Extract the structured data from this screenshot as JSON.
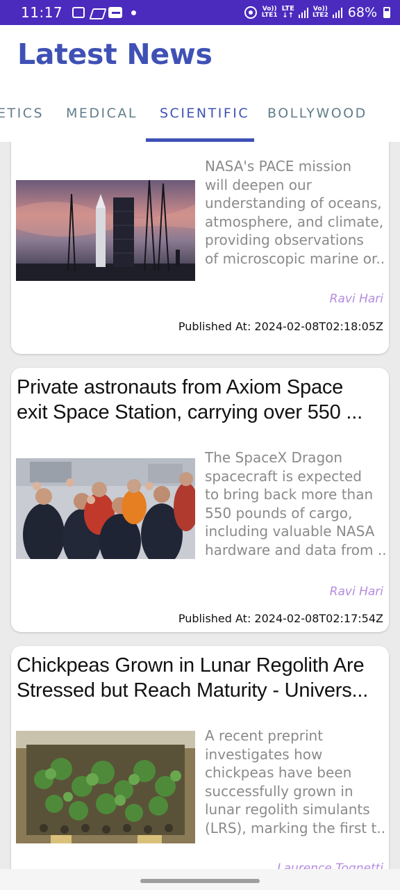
{
  "status_bar": {
    "time": "11:17",
    "volte1_top": "Vo))",
    "volte1_bottom": "LTE1",
    "lte_top": "LTE",
    "lte_bottom": "↓↑",
    "volte2_top": "Vo))",
    "volte2_bottom": "LTE2",
    "battery": "68%"
  },
  "app_bar": {
    "title": "Latest News"
  },
  "tabs": [
    {
      "label": "ETICS"
    },
    {
      "label": "MEDICAL"
    },
    {
      "label": "SCIENTIFIC",
      "active": true
    },
    {
      "label": "BOLLYWOOD"
    }
  ],
  "articles": [
    {
      "title_lines": [],
      "description_lines": [
        "NASA's PACE mission",
        "will deepen our",
        "understanding of oceans,",
        "atmosphere, and climate,",
        "providing observations",
        "of microscopic marine or..."
      ],
      "author": "Ravi Hari",
      "published": "Published At: 2024-02-08T02:18:05Z",
      "image": "rocket-launch-pad-photo"
    },
    {
      "title_lines": [
        "Private astronauts from Axiom Space",
        "exit Space Station, carrying over 550 ..."
      ],
      "description_lines": [
        "The SpaceX Dragon",
        "spacecraft is expected",
        "to bring back more than",
        "550 pounds of cargo,",
        "including valuable NASA",
        "hardware and data from ..."
      ],
      "author": "Ravi Hari",
      "published": "Published At: 2024-02-08T02:17:54Z",
      "image": "astronauts-group-photo"
    },
    {
      "title_lines": [
        "Chickpeas Grown in Lunar Regolith Are",
        "Stressed but Reach Maturity - Univers..."
      ],
      "description_lines": [
        "A recent preprint",
        "investigates how",
        "chickpeas have been",
        "successfully grown in",
        "lunar regolith simulants",
        "(LRS), marking the first t..."
      ],
      "author": "Laurence Tognetti",
      "image": "chickpea-plants-photo"
    }
  ],
  "colors": {
    "status_bar": "#4a2bbd",
    "accent": "#3f51b5",
    "tab_inactive": "#607d8b",
    "author": "#b48be0",
    "description": "#8a8a8a"
  }
}
